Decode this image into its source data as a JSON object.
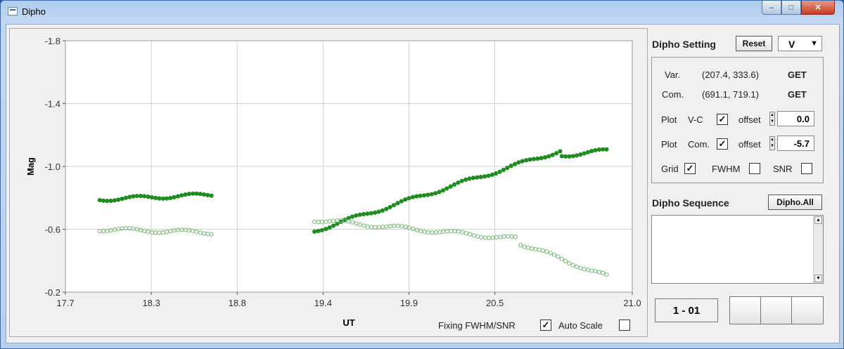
{
  "window": {
    "title": "Dipho",
    "min_glyph": "–",
    "max_glyph": "□",
    "close_glyph": "✕"
  },
  "plot": {
    "fixing_label": "Fixing FWHM/SNR",
    "fixing_checked": true,
    "autoscale_label": "Auto Scale",
    "autoscale_checked": false
  },
  "chart_data": {
    "type": "scatter",
    "xlabel": "UT",
    "ylabel": "Mag",
    "xlim": [
      17.7,
      21.0
    ],
    "ylim": [
      -1.8,
      -0.2
    ],
    "y_inverted": true,
    "xticks": [
      "17.7",
      "18.3",
      "18.8",
      "19.4",
      "19.9",
      "20.5",
      "21.0"
    ],
    "xtick_values": [
      17.7,
      18.2,
      18.7,
      19.2,
      19.7,
      20.2,
      21.0
    ],
    "yticks": [
      "-1.8",
      "-1.4",
      "-1.0",
      "-0.6",
      "-0.2"
    ],
    "ytick_values": [
      -1.8,
      -1.4,
      -1.0,
      -0.6,
      -0.2
    ],
    "grid": true,
    "series": [
      {
        "name": "V-C",
        "color": "#1e8c1e",
        "filled": true,
        "segments": [
          {
            "x_start": 17.9,
            "x_end": 18.55,
            "y_start": -0.79,
            "y_end": -0.82
          },
          {
            "x_start": 19.15,
            "x_end": 20.58,
            "y_start": -0.59,
            "y_end": -1.1
          },
          {
            "x_start": 20.59,
            "x_end": 20.85,
            "y_start": -1.07,
            "y_end": -1.1
          }
        ]
      },
      {
        "name": "Com.",
        "color": "#72b872",
        "filled": false,
        "segments": [
          {
            "x_start": 17.9,
            "x_end": 18.55,
            "y_start": -0.6,
            "y_end": -0.58
          },
          {
            "x_start": 19.15,
            "x_end": 20.32,
            "y_start": -0.66,
            "y_end": -0.54
          },
          {
            "x_start": 20.35,
            "x_end": 20.85,
            "y_start": -0.51,
            "y_end": -0.3
          }
        ]
      }
    ]
  },
  "settings": {
    "title": "Dipho Setting",
    "reset_label": "Reset",
    "filter_value": "V",
    "var_label": "Var.",
    "var_coord": "(207.4, 333.6)",
    "var_get": "GET",
    "com_label": "Com.",
    "com_coord": "(691.1, 719.1)",
    "com_get": "GET",
    "plot_label": "Plot",
    "plot_vc_label": "V-C",
    "plot_vc_checked": true,
    "offset_label": "offset",
    "offset_vc": "0.0",
    "plot_com_label": "Com.",
    "plot_com_checked": true,
    "offset_com": "-5.7",
    "grid_label": "Grid",
    "grid_checked": true,
    "fwhm_label": "FWHM",
    "fwhm_checked": false,
    "snr_label": "SNR",
    "snr_checked": false
  },
  "sequence": {
    "title": "Dipho Sequence",
    "dipho_all_label": "Dipho.All",
    "frame_label": "1 - 01"
  }
}
